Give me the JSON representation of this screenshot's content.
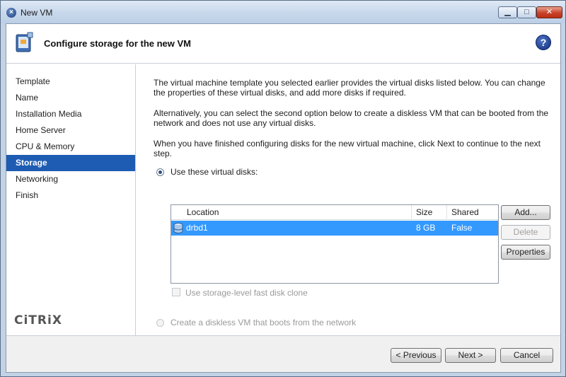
{
  "window": {
    "title": "New VM",
    "icon": "citrix-x-icon",
    "minimize_glyph": "▁",
    "maximize_glyph": "□",
    "close_glyph": "✕"
  },
  "header": {
    "title": "Configure storage for the new VM",
    "help_glyph": "?"
  },
  "nav": {
    "items": [
      {
        "label": "Template"
      },
      {
        "label": "Name"
      },
      {
        "label": "Installation Media"
      },
      {
        "label": "Home Server"
      },
      {
        "label": "CPU & Memory"
      },
      {
        "label": "Storage",
        "selected": true
      },
      {
        "label": "Networking"
      },
      {
        "label": "Finish"
      }
    ],
    "logo_text": "CiTRiX"
  },
  "content": {
    "para1": "The virtual machine template you selected earlier provides the virtual disks listed below. You can change the properties of these virtual disks, and add more disks if required.",
    "para2": "Alternatively, you can select the second option below to create a diskless VM that can be booted from the network and does not use any virtual disks.",
    "para3": "When you have finished configuring disks for the new virtual machine, click Next to continue to the next step.",
    "option_disks": "Use these virtual disks:",
    "option_diskless": "Create a diskless VM that boots from the network",
    "fast_clone_label": "Use storage-level fast disk clone"
  },
  "disk_table": {
    "columns": [
      "Location",
      "Size",
      "Shared"
    ],
    "rows": [
      {
        "location": "drbd1",
        "size": "8 GB",
        "shared": "False"
      }
    ]
  },
  "side_buttons": {
    "add": "Add...",
    "delete": "Delete",
    "properties": "Properties"
  },
  "footer": {
    "previous": "< Previous",
    "next": "Next >",
    "cancel": "Cancel"
  },
  "colors": {
    "selection": "#1e5cb3",
    "row_highlight": "#3399ff"
  }
}
